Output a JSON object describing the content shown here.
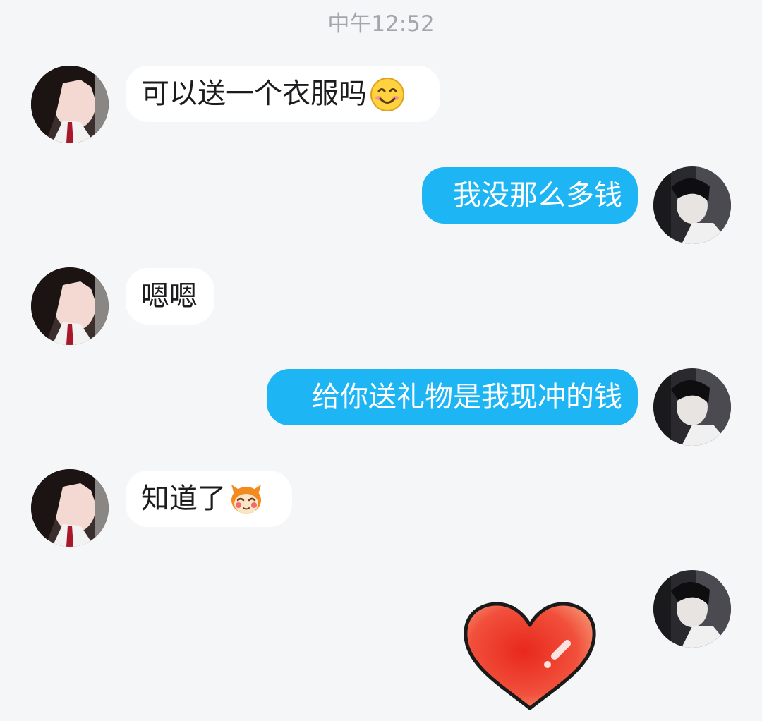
{
  "chat": {
    "timestamp": "中午12:52",
    "messages": [
      {
        "sender": "contact",
        "text": "可以送一个衣服吗",
        "emoji": "smiling-face-emoji"
      },
      {
        "sender": "me",
        "text": "我没那么多钱"
      },
      {
        "sender": "contact",
        "text": "嗯嗯"
      },
      {
        "sender": "me",
        "text": "给你送礼物是我现冲的钱"
      },
      {
        "sender": "contact",
        "text": "知道了",
        "emoji": "monkey-blush-emoji"
      },
      {
        "sender": "me",
        "sticker": "red-heart-sticker"
      }
    ]
  },
  "colors": {
    "background": "#f5f6f8",
    "incoming_bubble": "#ffffff",
    "outgoing_bubble": "#1eb5f5",
    "timestamp_text": "#a2a6ad"
  }
}
